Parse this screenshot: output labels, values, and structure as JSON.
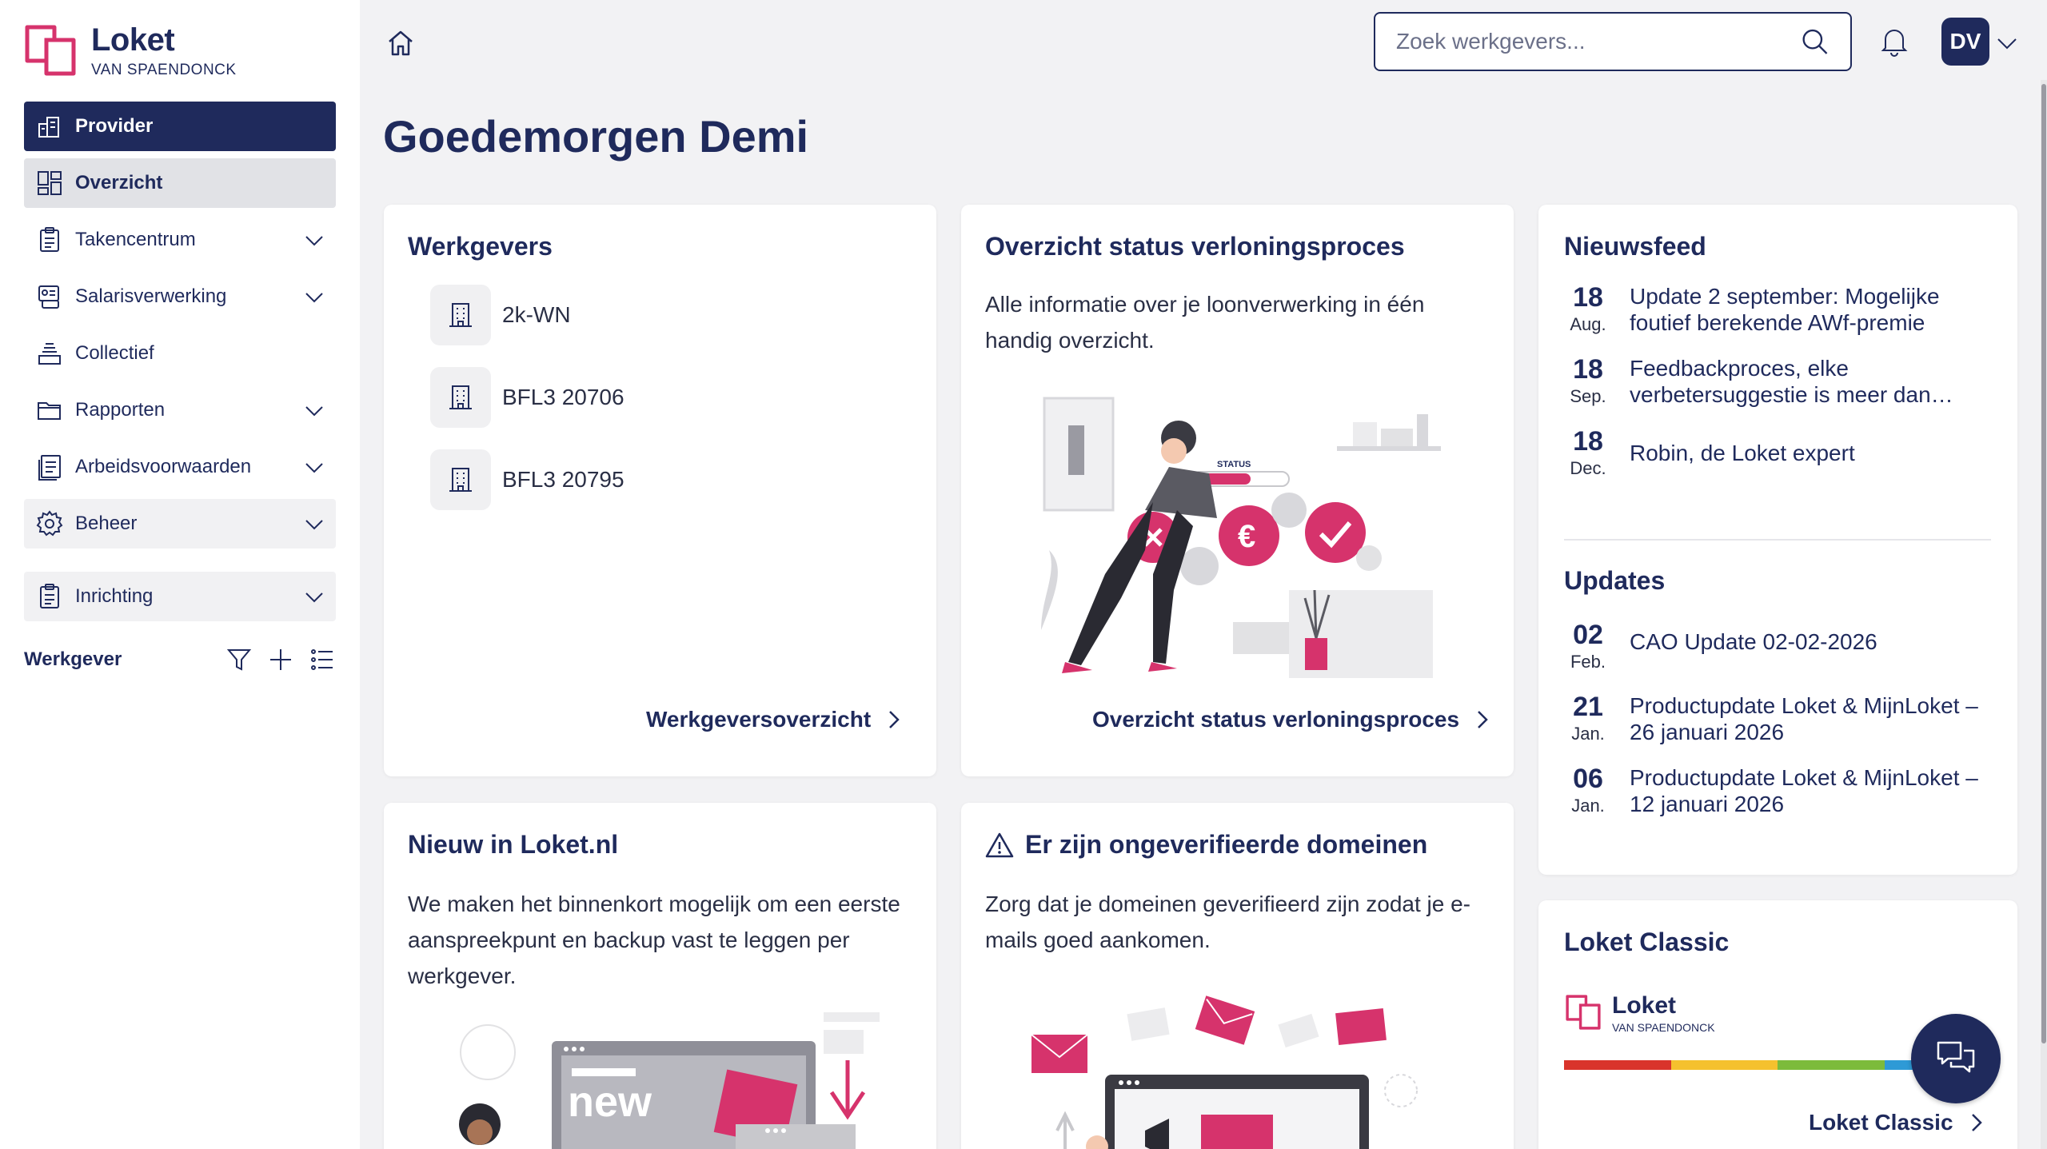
{
  "brand": {
    "title": "Loket",
    "subtitle": "VAN SPAENDONCK",
    "accent": "#d6336c",
    "primary": "#1f2a5c"
  },
  "sidebar": {
    "items": [
      {
        "label": "Provider",
        "icon": "building-chart-icon"
      },
      {
        "label": "Overzicht",
        "icon": "dashboard-icon"
      },
      {
        "label": "Takencentrum",
        "icon": "clipboard-icon"
      },
      {
        "label": "Salarisverwerking",
        "icon": "payroll-icon"
      },
      {
        "label": "Collectief",
        "icon": "stack-icon"
      },
      {
        "label": "Rapporten",
        "icon": "folder-icon"
      },
      {
        "label": "Arbeidsvoorwaarden",
        "icon": "document-list-icon"
      },
      {
        "label": "Beheer",
        "icon": "gear-icon"
      },
      {
        "label": "Inrichting",
        "icon": "clipboard-icon"
      }
    ],
    "werkgever_label": "Werkgever"
  },
  "search": {
    "placeholder": "Zoek werkgevers..."
  },
  "user": {
    "initials": "DV"
  },
  "greeting": "Goedemorgen Demi",
  "werkgevers": {
    "title": "Werkgevers",
    "items": [
      "2k-WN",
      "BFL3 20706",
      "BFL3 20795"
    ],
    "link": "Werkgeversoverzicht"
  },
  "status": {
    "title": "Overzicht status verloningsproces",
    "text": "Alle informatie over je loonverwerking in één handig overzicht.",
    "illustration_label": "STATUS",
    "link": "Overzicht status verloningsproces"
  },
  "nieuwsfeed": {
    "title": "Nieuwsfeed",
    "items": [
      {
        "day": "18",
        "month": "Aug.",
        "text": "Update 2 september: Mogelijke foutief berekende AWf-premie"
      },
      {
        "day": "18",
        "month": "Sep.",
        "text": "Feedbackproces, elke verbetersuggestie is meer dan…"
      },
      {
        "day": "18",
        "month": "Dec.",
        "text": "Robin, de Loket expert"
      }
    ]
  },
  "updates": {
    "title": "Updates",
    "items": [
      {
        "day": "02",
        "month": "Feb.",
        "text": "CAO Update 02-02-2026"
      },
      {
        "day": "21",
        "month": "Jan.",
        "text": "Productupdate Loket & MijnLoket – 26 januari 2026"
      },
      {
        "day": "06",
        "month": "Jan.",
        "text": "Productupdate Loket & MijnLoket – 12 januari 2026"
      }
    ]
  },
  "nieuw": {
    "title": "Nieuw in Loket.nl",
    "text": "We maken het binnenkort mogelijk om een eerste aanspreekpunt en backup vast te leggen per werkgever.",
    "illustration_label": "new"
  },
  "domein": {
    "title": "Er zijn ongeverifieerde domeinen",
    "text": "Zorg dat je domeinen geverifieerd zijn zodat je e-mails goed aankomen."
  },
  "classic": {
    "title": "Loket Classic",
    "logo_title": "Loket",
    "logo_sub": "VAN SPAENDONCK",
    "link": "Loket Classic",
    "stripe_colors": [
      "#d9342b",
      "#f5c12e",
      "#7cbb3b",
      "#2e9ad6"
    ]
  }
}
